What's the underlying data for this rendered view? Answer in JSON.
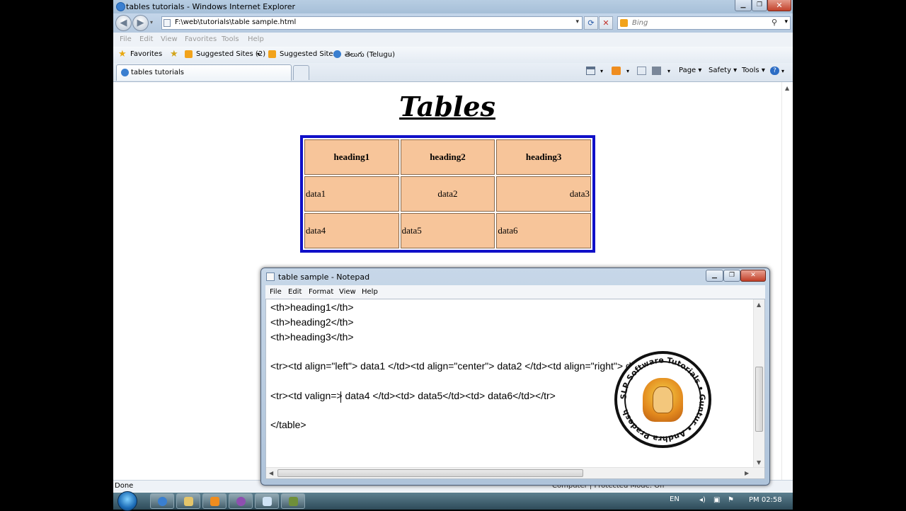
{
  "ie": {
    "window_title": "tables tutorials - Windows Internet Explorer",
    "address_url": "F:\\web\\tutorials\\table sample.html",
    "search_placeholder": "Bing",
    "menu": [
      "File",
      "Edit",
      "View",
      "Favorites",
      "Tools",
      "Help"
    ],
    "favorites_label": "Favorites",
    "favorites_items": [
      "Suggested Sites (2)",
      "Suggested Sites",
      "తెలుగు (Telugu)"
    ],
    "tab_label": "tables tutorials",
    "command_bar": [
      "Page",
      "Safety",
      "Tools"
    ],
    "status_text": "Done",
    "status_zone": "Computer | Protected Mode: Off"
  },
  "page": {
    "title": "Tables",
    "table": {
      "headers": [
        "heading1",
        "heading2",
        "heading3"
      ],
      "rows": [
        [
          "data1",
          "data2",
          "data3"
        ],
        [
          "data4",
          "data5",
          "data6"
        ]
      ],
      "border_color": "#1010c8",
      "cell_color": "#f7c59a"
    }
  },
  "notepad": {
    "title": "table sample - Notepad",
    "menu": [
      "File",
      "Edit",
      "Format",
      "View",
      "Help"
    ],
    "lines": [
      "<th>heading1</th>",
      "<th>heading2</th>",
      "<th>heading3</th>",
      "",
      "<tr><td align=\"left\"> data1 </td><td align=\"center\"> data2 </td><td align=\"right\"> data3 </td></tr>",
      "",
      "<tr><td valign=> data4 </td><td> data5</td><td> data6</td></tr>",
      "",
      "</table>"
    ]
  },
  "watermark": {
    "text": "SLP Software Tutorials • Guntur • Andhra Pradesh"
  },
  "taskbar": {
    "language": "EN",
    "clock": "PM 02:58"
  }
}
